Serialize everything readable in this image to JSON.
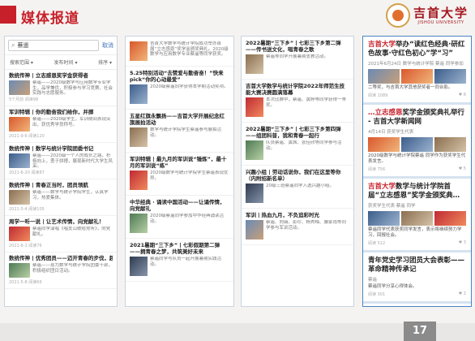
{
  "slide": {
    "title": "媒体报道",
    "logo_cn": "吉首大学",
    "logo_en": "JISHOU UNIVERSITY",
    "page_number": "17"
  },
  "search_panel": {
    "query": "蔡遥",
    "cancel": "取消",
    "filters": [
      "搜索范围 ▾",
      "发布时间 ▾",
      "排序 ▾"
    ],
    "results": [
      {
        "title": "数统传神 | 立志感恩奖学金获得者",
        "text": "蔡遥——2020级数学与应用数学专业学生，品学兼优，积极参与学习竞赛、社会实践与志愿服务。",
        "meta": "5个月前  阅读98"
      },
      {
        "title": "军训特辑 | 你的勤奋我们给你，并掷",
        "text": "蔡遥——2020级学生，军训期间表现突出，获优秀学员称号。",
        "meta": "2021-9-6  阅读120"
      },
      {
        "title": "数统传神 | 数学与统计学院团委书记",
        "text": "蔡遥——2020级一个人的成长之路，积极向上，勇于拼搏，展现新时代大学生风采。",
        "meta": "2021-6-20  阅读87"
      },
      {
        "title": "数统传神 | 青春正当时，团员领航",
        "text": "蔡遥——数学与统计学院学生，认真学习，热爱集体。",
        "meta": "2021-5-4  阅读105"
      },
      {
        "title": "周学一听一说 | 让艺术传情，向党献礼！",
        "text": "蔡遥同学演唱《唱支山歌给党听》，向党献礼。",
        "meta": "2021-6-1  阅读76"
      },
      {
        "title": "数统传神 | 优秀团员——迈开青春的步伐，超翔",
        "text": "蔡遥——现为数学与统计学院团委干部，积极组织团日活动。",
        "meta": "2021-5-8  阅读66"
      }
    ]
  },
  "list_panel_2": {
    "articles": [
      {
        "title": "",
        "text": "吉首大学数学与统计学院成功举办首届“立志感恩”奖学金颁奖典礼。2020级数学与应用数学专业蔡遥等同学获奖。",
        "meta": ""
      },
      {
        "title": "5.25特别活动“去赞爱与勤奋奋！”快来pick“你的心动最爱”",
        "text": "2020级蔡遥同学获得本学期活动奖项。",
        "meta": ""
      },
      {
        "title": "五星红旗永飘扬——吉首大学开展纪念红旗展拍活动",
        "text": "数学与统计学院学生蔡遥参与展拍活动。",
        "meta": ""
      },
      {
        "title": "军训特辑 | 最九月的军训说“锤炼”，最十月的军训说“练”",
        "text": "2020级数学与统计学院学生蔡遥表现优异。",
        "meta": ""
      },
      {
        "title": "中华经典 · 诵读中国活动——让诵传情，向党献礼",
        "text": "2020级蔡遥同学参加中华经典诵读活动。",
        "meta": ""
      },
      {
        "title": "2021暑期“三下乡”丨七彩假期第二弹——拥青春之梦，共筑美好未来",
        "text": "蔡遥同学与队员一起开展暑期实践活动。",
        "meta": ""
      }
    ]
  },
  "list_panel_3": {
    "articles": [
      {
        "title": "2022暑期“三下乡”丨七彩三下乡第二弹——传书送文化，唱青春之歌",
        "text": "蔡遥等同学开展暑期支教活动。",
        "meta": ""
      },
      {
        "title": "吉首大学数学与统计学院2022年师范生技能大赛决赛圆满落幕",
        "text": "本次比赛中，蔡遥、黄婷等同学获得一等奖。",
        "meta": ""
      },
      {
        "title": "2022暑期“三下乡”丨七彩三下乡第四弹——组团科普，我和青春一起行",
        "text": "队员蔡遥、黄茜、张佳欣等同学参与活动。",
        "meta": ""
      },
      {
        "title": "兴趣小组 | 劳动话说你，我们在这里等你（内附招新名单）",
        "text": "20级三班蔡遥同学入选兴趣小组。",
        "meta": ""
      },
      {
        "title": "军训丨热血九月，不负追彩时光",
        "text": "蔡遥、向薇、彭珍、杨秀梅、滕家雨等同学参与军训活动。",
        "meta": ""
      }
    ]
  },
  "news_panel": {
    "items": [
      {
        "title_red": "吉首大学",
        "title_dark": "举办“读红色经典·研红色故事·守红色初心”学“习”",
        "date": "2021年6月24日 数学与统计学院 蔡遥 同学参加",
        "body": "二等奖，与吉首大学其他获奖者一同合影。",
        "meta_left": "阅读 1089",
        "meta_right": "♥ 8"
      },
      {
        "title_red": "…立志感恩",
        "title_dark": "奖学金颁奖典礼举行 - 吉首大学新闻网",
        "date": "4月14日 获奖学生代表",
        "body": "2020级数学与统计学院蔡遥 同学作为获奖学生代表发言。",
        "meta_left": "阅读 756",
        "meta_right": "♥ 5"
      },
      {
        "title_red": "吉首大学",
        "title_dark": "数学与统计学院首届“立志感恩”奖学金颁奖典…",
        "date": "获奖学生代表 蔡遥 同学",
        "body": "蔡遥同学代表获奖同学发言，表示将继续努力学习，回报社会。",
        "meta_left": "阅读 512",
        "meta_right": "♥ 3"
      },
      {
        "title_red": "",
        "title_dark": "青年党史学习团员大会表彰——革命精神传承记",
        "date": "蔡遥",
        "body": "蔡遥同学分享心得体会。",
        "meta_left": "阅读 301",
        "meta_right": "♥ 2"
      }
    ]
  }
}
